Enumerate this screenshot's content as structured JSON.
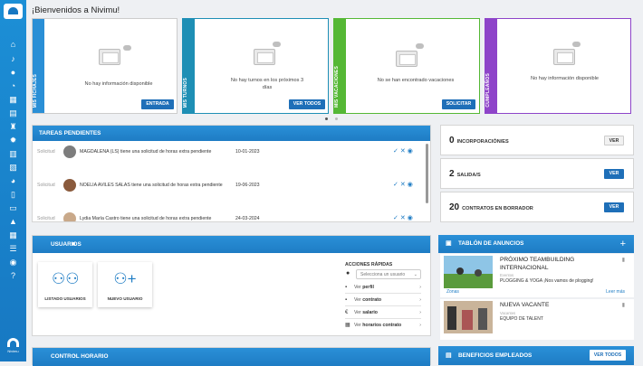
{
  "welcome": "¡Bienvenidos a Nivimu!",
  "sidebar": {
    "icons": [
      "home-icon",
      "bell-icon",
      "users-icon",
      "clock-icon",
      "calendar-icon",
      "id-card-icon",
      "trophy-icon",
      "gear-icon",
      "document-icon",
      "chart-icon",
      "pie-chart-icon",
      "file-icon",
      "wallet-icon",
      "graduation-icon",
      "table-icon",
      "list-icon",
      "globe-icon",
      "help-icon"
    ],
    "brand": "Nivimu"
  },
  "cards": [
    {
      "label": "MIS FICHAJES",
      "message": "No hay información disponible",
      "button": "ENTRADA",
      "color": "#2a8fd6"
    },
    {
      "label": "MIS TURNOS",
      "message": "No hay turnos en los próximos 3 días",
      "button": "VER TODOS",
      "color": "#1e8fb5"
    },
    {
      "label": "MIS VACACIONES",
      "message": "No se han encontrado vacaciones",
      "button": "SOLICITAR",
      "color": "#55b835"
    },
    {
      "label": "CUMPLEAÑOS",
      "message": "No hay información disponible",
      "button": "",
      "color": "#8e44c9"
    }
  ],
  "tasks": {
    "title": "TAREAS PENDIENTES",
    "rows": [
      {
        "kind": "Solicitud",
        "text": "MAGDALENA (LS) tiene una solicitud de horas extra pendiente",
        "date": "10-01-2023"
      },
      {
        "kind": "Solicitud",
        "text": "NOELIA AVILES SALAS tiene una solicitud de horas extra pendiente",
        "date": "19-06-2023"
      },
      {
        "kind": "Solicitud",
        "text": "Lydia María Castro tiene una solicitud de horas extra pendiente",
        "date": "24-03-2024"
      }
    ]
  },
  "stats": [
    {
      "num": "0",
      "label": "INCORPORACIÓN/ES",
      "button": "VER",
      "primary": false
    },
    {
      "num": "2",
      "label": "SALIDA/S",
      "button": "VER",
      "primary": true
    },
    {
      "num": "20",
      "label": "CONTRATOS EN BORRADOR",
      "button": "VER",
      "primary": true
    }
  ],
  "usuarios": {
    "title": "USUARIOS",
    "tiles": [
      "LISTADO USUARIOS",
      "NUEVO USUARIO"
    ],
    "quick_title": "ACCIONES RÁPIDAS",
    "select_placeholder": "Selecciona un usuario",
    "quick": [
      {
        "pre": "Ver",
        "bold": "perfil"
      },
      {
        "pre": "Ver",
        "bold": "contrato"
      },
      {
        "pre": "Ver",
        "bold": "salario"
      },
      {
        "pre": "Ver",
        "bold": "horarios contrato"
      }
    ]
  },
  "board": {
    "title": "TABLÓN DE ANUNCIOS",
    "items": [
      {
        "title": "PRÓXIMO TEAMBUILDING INTERNACIONAL",
        "sub": "Eventos",
        "desc": "PLOGGING & YOGA ¡Nos vamos de plogging!",
        "footer_left": "Zonas",
        "footer_right": "Leer más"
      },
      {
        "title": "NUEVA VACANTE",
        "sub": "Vacantes",
        "desc": "EQUIPO DE TALENT"
      }
    ]
  },
  "control": {
    "title": "CONTROL HORARIO"
  },
  "benefits": {
    "title": "BENEFICIOS EMPLEADOS",
    "button": "VER TODOS"
  },
  "colors": {
    "primary": "#1e7cc4"
  }
}
